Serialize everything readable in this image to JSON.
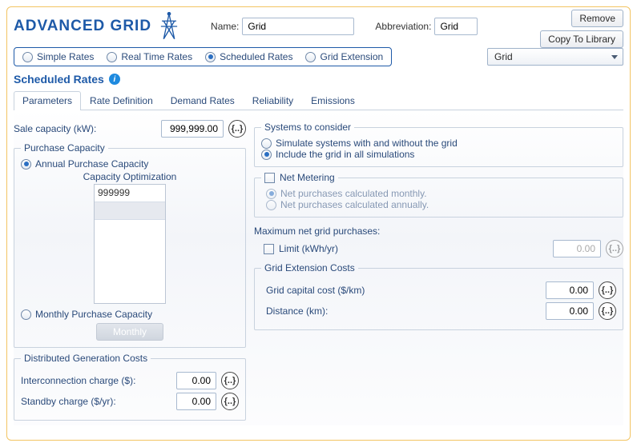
{
  "header": {
    "title": "ADVANCED GRID",
    "name_label": "Name:",
    "name_value": "Grid",
    "abbrev_label": "Abbreviation:",
    "abbrev_value": "Grid",
    "remove_btn": "Remove",
    "copy_btn": "Copy To Library"
  },
  "modes": {
    "simple": "Simple Rates",
    "realtime": "Real Time Rates",
    "scheduled": "Scheduled Rates",
    "extension": "Grid Extension",
    "combo_value": "Grid"
  },
  "section_title": "Scheduled Rates",
  "tabs": {
    "parameters": "Parameters",
    "rate_def": "Rate Definition",
    "demand": "Demand Rates",
    "reliability": "Reliability",
    "emissions": "Emissions"
  },
  "left": {
    "sale_cap_label": "Sale capacity (kW):",
    "sale_cap_value": "999,999.00",
    "purchase_cap_legend": "Purchase Capacity",
    "annual_opt": "Annual Purchase Capacity",
    "cap_opt_header": "Capacity Optimization",
    "cap_opt_value": "999999",
    "monthly_opt": "Monthly Purchase Capacity",
    "monthly_btn": "Monthly",
    "dist_legend": "Distributed Generation Costs",
    "interconn_label": "Interconnection charge ($):",
    "interconn_value": "0.00",
    "standby_label": "Standby charge ($/yr):",
    "standby_value": "0.00"
  },
  "right": {
    "systems_legend": "Systems to consider",
    "systems_opt1": "Simulate systems with and without the grid",
    "systems_opt2": "Include the grid in all simulations",
    "netmeter_label": "Net Metering",
    "net_monthly": "Net purchases calculated monthly.",
    "net_annually": "Net purchases calculated annually.",
    "max_net_label": "Maximum net grid purchases:",
    "limit_label": "Limit (kWh/yr)",
    "limit_value": "0.00",
    "ext_legend": "Grid Extension Costs",
    "capital_label": "Grid capital cost ($/km)",
    "capital_value": "0.00",
    "dist_label": "Distance (km):",
    "dist_value": "0.00"
  },
  "glyphs": {
    "curly": "{..}"
  }
}
